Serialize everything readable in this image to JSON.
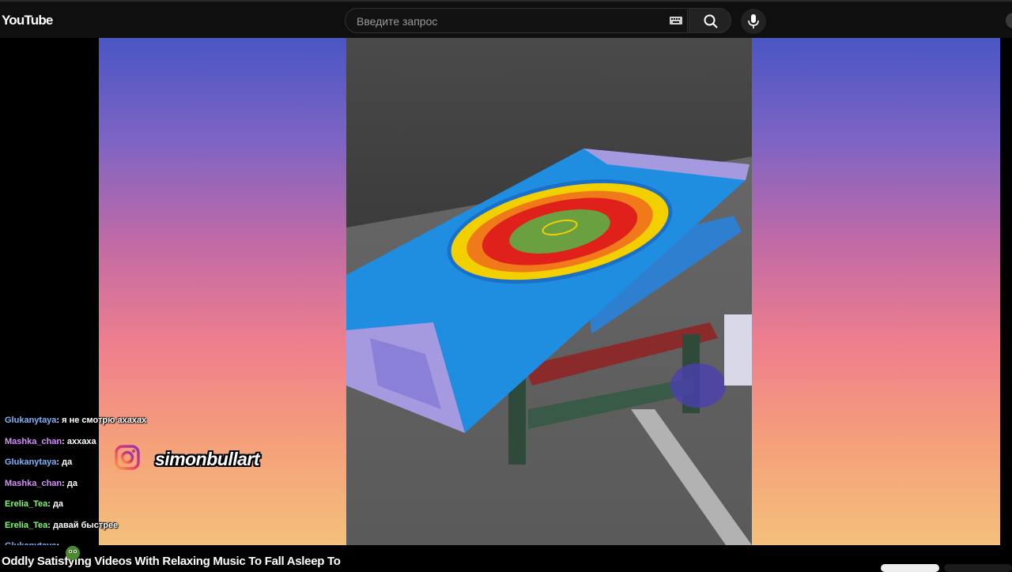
{
  "header": {
    "logo_text": "YouTube",
    "search_placeholder": "Введите запрос",
    "icons": [
      "keyboard-icon",
      "search-icon",
      "mic-icon"
    ]
  },
  "overlay": {
    "instagram_handle": "simonbullart",
    "icon": "instagram-icon"
  },
  "chat": {
    "messages": [
      {
        "user": "Glukanytaya",
        "text": ": я не смотрю ахахах",
        "color": "#7ab3ff"
      },
      {
        "user": "Mashka_chan",
        "text": ": аххаха",
        "color": "#d88cff"
      },
      {
        "user": "Glukanytaya",
        "text": ": да",
        "color": "#7ab3ff"
      },
      {
        "user": "Mashka_chan",
        "text": ": да",
        "color": "#d88cff"
      },
      {
        "user": "Erelia_Tea",
        "text": ": да",
        "color": "#7cff6a"
      },
      {
        "user": "Erelia_Tea",
        "text": ": давай быстрее",
        "color": "#7cff6a"
      },
      {
        "user": "Glukanytaya",
        "text": ":",
        "color": "#7ab3ff"
      }
    ]
  },
  "video": {
    "title": "Oddly Satisfying Videos With Relaxing Music To Fall Asleep To"
  },
  "colors": {
    "topbar_bg": "#0f0f0f",
    "gradient_top": "#4a55c4",
    "gradient_bottom": "#f4c07a"
  }
}
